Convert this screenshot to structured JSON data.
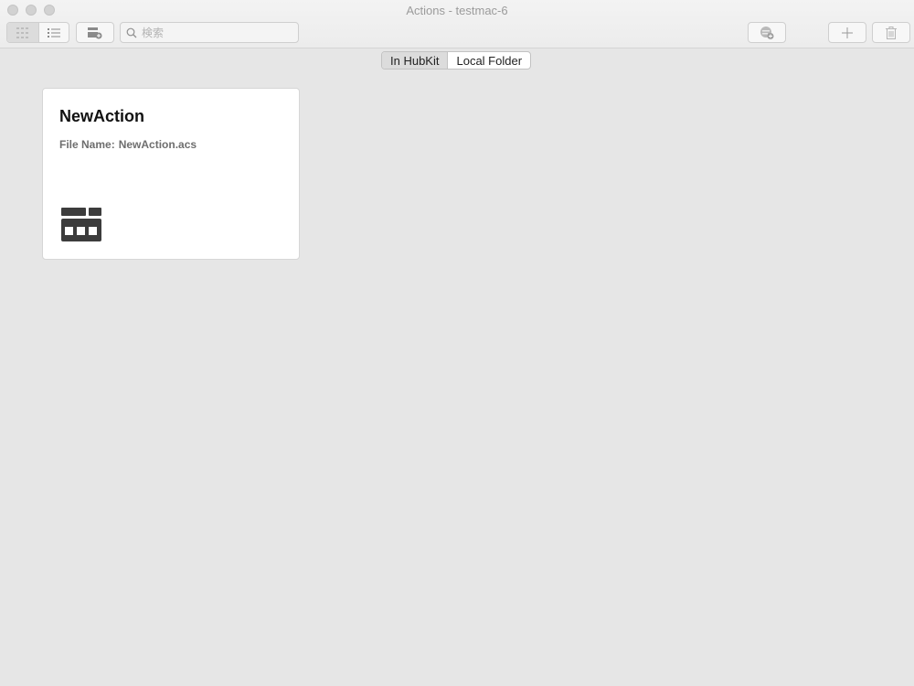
{
  "window": {
    "title": "Actions - testmac-6"
  },
  "toolbar": {
    "search_placeholder": "検索",
    "view_grid_icon": "grid-view-icon",
    "view_list_icon": "list-view-icon",
    "new_group_icon": "new-group-icon",
    "share_icon": "share-icon",
    "add_icon": "plus-icon",
    "delete_icon": "trash-icon"
  },
  "source_segment": {
    "options": [
      "In HubKit",
      "Local Folder"
    ],
    "selected": "In HubKit"
  },
  "actions": [
    {
      "name": "NewAction",
      "file_label": "File Name:",
      "file_name": "NewAction.acs",
      "icon": "action-layout-icon"
    }
  ]
}
